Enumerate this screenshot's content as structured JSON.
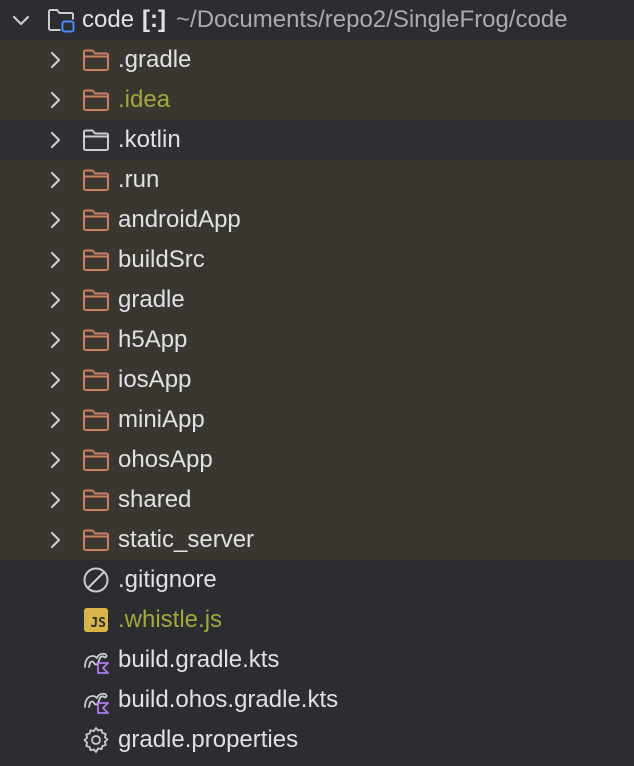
{
  "root": {
    "name": "code",
    "flag": "[:]",
    "path": "~/Documents/repo2/SingleFrog/code"
  },
  "folders": [
    {
      "label": ".gradle",
      "muted": false,
      "selected": false
    },
    {
      "label": ".idea",
      "muted": true,
      "selected": false
    },
    {
      "label": ".kotlin",
      "muted": false,
      "selected": true
    },
    {
      "label": ".run",
      "muted": false,
      "selected": false
    },
    {
      "label": "androidApp",
      "muted": false,
      "selected": false
    },
    {
      "label": "buildSrc",
      "muted": false,
      "selected": false
    },
    {
      "label": "gradle",
      "muted": false,
      "selected": false
    },
    {
      "label": "h5App",
      "muted": false,
      "selected": false
    },
    {
      "label": "iosApp",
      "muted": false,
      "selected": false
    },
    {
      "label": "miniApp",
      "muted": false,
      "selected": false
    },
    {
      "label": "ohosApp",
      "muted": false,
      "selected": false
    },
    {
      "label": "shared",
      "muted": false,
      "selected": false
    },
    {
      "label": "static_server",
      "muted": false,
      "selected": false
    }
  ],
  "files": [
    {
      "label": ".gitignore",
      "icon": "ignore-icon",
      "muted": false
    },
    {
      "label": ".whistle.js",
      "icon": "javascript-icon",
      "muted": true,
      "badge": "JS"
    },
    {
      "label": "build.gradle.kts",
      "icon": "gradle-kotlin-icon",
      "muted": false
    },
    {
      "label": "build.ohos.gradle.kts",
      "icon": "gradle-kotlin-icon",
      "muted": false
    },
    {
      "label": "gradle.properties",
      "icon": "gear-icon",
      "muted": false
    }
  ],
  "colors": {
    "folder_orange": "#c9805f",
    "folder_gray": "#c9ccd3",
    "muted_text": "#a4a838",
    "text": "#dfe1e5",
    "dir_row_bg": "#3a3730",
    "selected_row_bg": "#2f3033",
    "panel_bg": "#2b2d30"
  }
}
